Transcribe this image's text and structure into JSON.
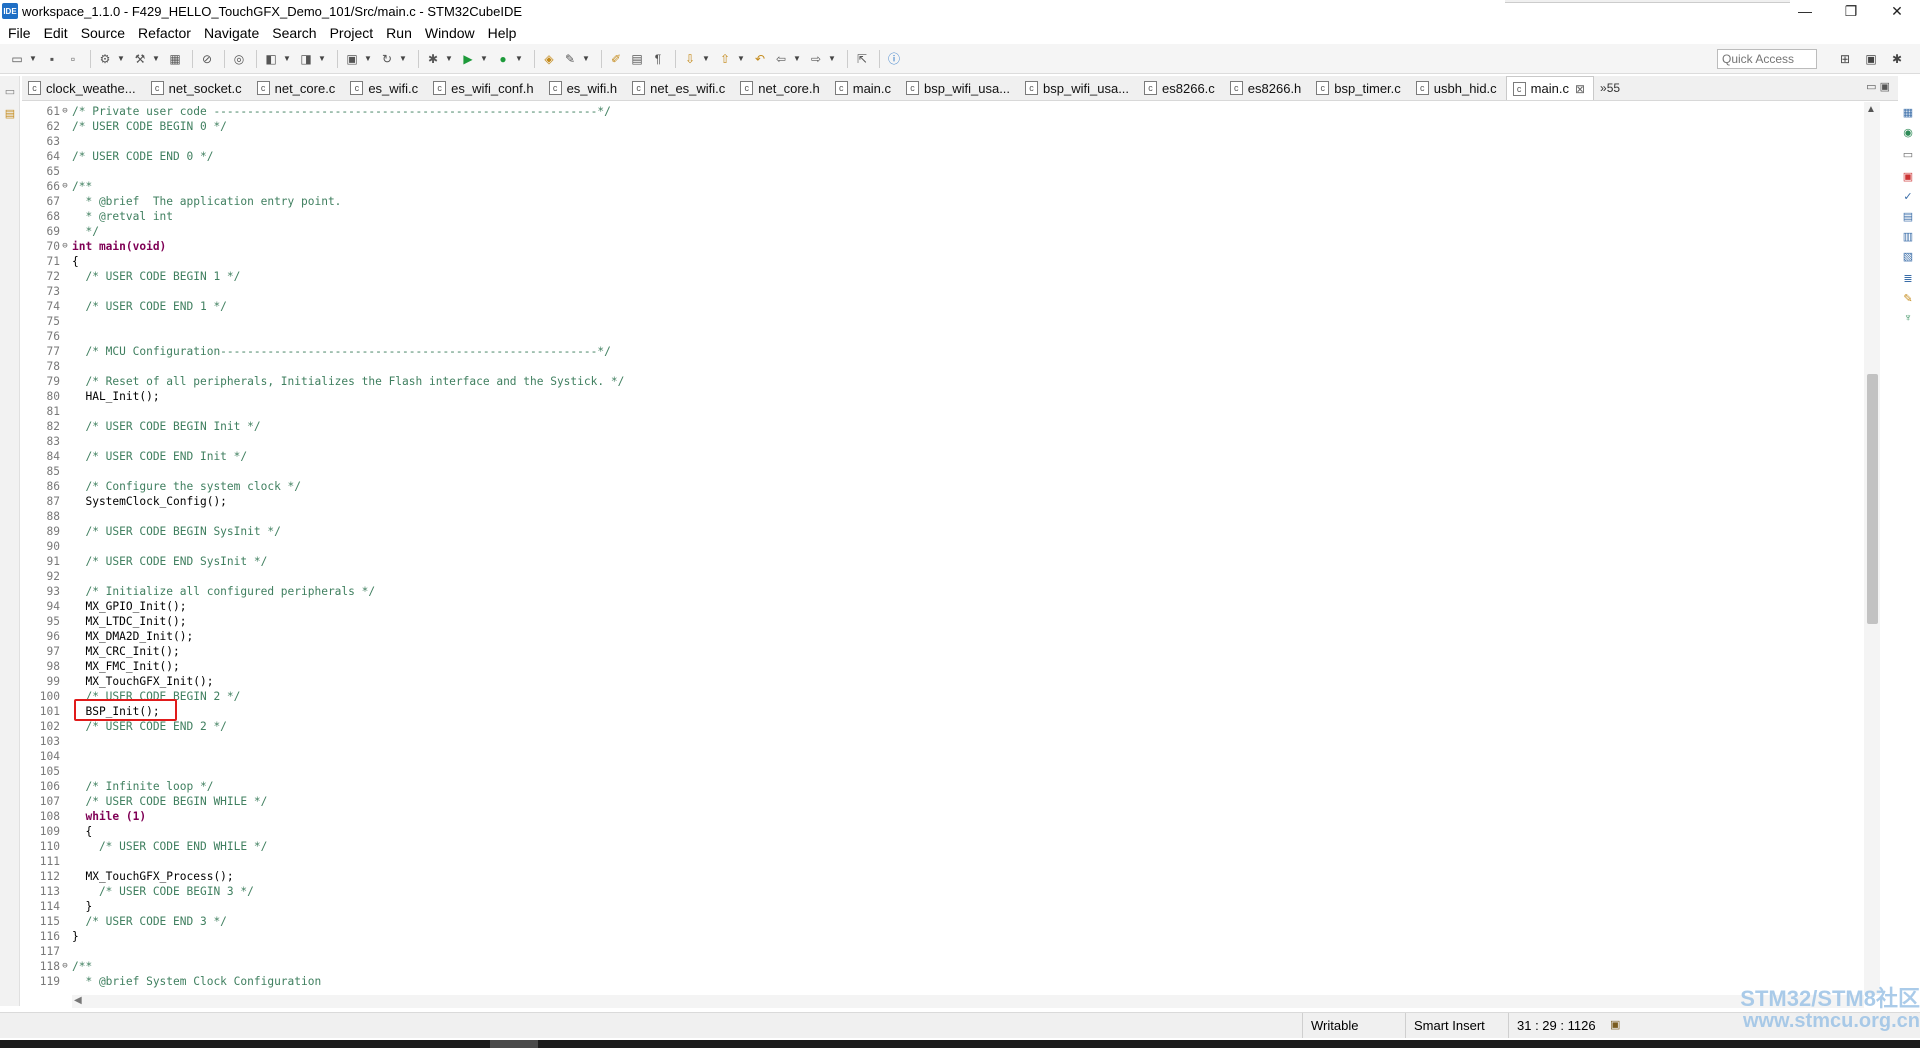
{
  "window": {
    "title": "workspace_1.1.0 - F429_HELLO_TouchGFX_Demo_101/Src/main.c - STM32CubeIDE",
    "app_icon": "IDE",
    "controls": {
      "minimize": "—",
      "maximize": "❐",
      "close": "✕"
    }
  },
  "menu": [
    "File",
    "Edit",
    "Source",
    "Refactor",
    "Navigate",
    "Search",
    "Project",
    "Run",
    "Window",
    "Help"
  ],
  "toolbar": {
    "quick_access_placeholder": "Quick Access"
  },
  "tabs": [
    {
      "label": "clock_weathe...",
      "active": false
    },
    {
      "label": "net_socket.c",
      "active": false
    },
    {
      "label": "net_core.c",
      "active": false
    },
    {
      "label": "es_wifi.c",
      "active": false
    },
    {
      "label": "es_wifi_conf.h",
      "active": false
    },
    {
      "label": "es_wifi.h",
      "active": false
    },
    {
      "label": "net_es_wifi.c",
      "active": false
    },
    {
      "label": "net_core.h",
      "active": false
    },
    {
      "label": "main.c",
      "active": false
    },
    {
      "label": "bsp_wifi_usa...",
      "active": false
    },
    {
      "label": "bsp_wifi_usa...",
      "active": false
    },
    {
      "label": "es8266.c",
      "active": false
    },
    {
      "label": "es8266.h",
      "active": false
    },
    {
      "label": "bsp_timer.c",
      "active": false
    },
    {
      "label": "usbh_hid.c",
      "active": false
    },
    {
      "label": "main.c",
      "active": true
    }
  ],
  "tab_overflow": "»55",
  "editor": {
    "lines": [
      {
        "n": "61",
        "fold": "⊖",
        "t": "/* Private user code ---------------------------------------------------------*/",
        "s": "comment"
      },
      {
        "n": "62",
        "t": "/* USER CODE BEGIN 0 */",
        "s": "comment"
      },
      {
        "n": "63",
        "t": "",
        "s": ""
      },
      {
        "n": "64",
        "t": "/* USER CODE END 0 */",
        "s": "comment"
      },
      {
        "n": "65",
        "t": "",
        "s": ""
      },
      {
        "n": "66",
        "fold": "⊖",
        "t": "/**",
        "s": "comment"
      },
      {
        "n": "67",
        "t": "  * @brief  The application entry point.",
        "s": "comment"
      },
      {
        "n": "68",
        "t": "  * @retval int",
        "s": "comment"
      },
      {
        "n": "69",
        "t": "  */",
        "s": "comment"
      },
      {
        "n": "70",
        "fold": "⊖",
        "t": "int main(void)",
        "s": "kw"
      },
      {
        "n": "71",
        "t": "{",
        "s": ""
      },
      {
        "n": "72",
        "t": "  /* USER CODE BEGIN 1 */",
        "s": "comment"
      },
      {
        "n": "73",
        "t": "",
        "s": ""
      },
      {
        "n": "74",
        "t": "  /* USER CODE END 1 */",
        "s": "comment"
      },
      {
        "n": "75",
        "t": "",
        "s": ""
      },
      {
        "n": "76",
        "t": "",
        "s": ""
      },
      {
        "n": "77",
        "t": "  /* MCU Configuration--------------------------------------------------------*/",
        "s": "comment"
      },
      {
        "n": "78",
        "t": "",
        "s": ""
      },
      {
        "n": "79",
        "t": "  /* Reset of all peripherals, Initializes the Flash interface and the Systick. */",
        "s": "comment"
      },
      {
        "n": "80",
        "t": "  HAL_Init();",
        "s": ""
      },
      {
        "n": "81",
        "t": "",
        "s": ""
      },
      {
        "n": "82",
        "t": "  /* USER CODE BEGIN Init */",
        "s": "comment"
      },
      {
        "n": "83",
        "t": "",
        "s": ""
      },
      {
        "n": "84",
        "t": "  /* USER CODE END Init */",
        "s": "comment"
      },
      {
        "n": "85",
        "t": "",
        "s": ""
      },
      {
        "n": "86",
        "t": "  /* Configure the system clock */",
        "s": "comment"
      },
      {
        "n": "87",
        "t": "  SystemClock_Config();",
        "s": ""
      },
      {
        "n": "88",
        "t": "",
        "s": ""
      },
      {
        "n": "89",
        "t": "  /* USER CODE BEGIN SysInit */",
        "s": "comment"
      },
      {
        "n": "90",
        "t": "",
        "s": ""
      },
      {
        "n": "91",
        "t": "  /* USER CODE END SysInit */",
        "s": "comment"
      },
      {
        "n": "92",
        "t": "",
        "s": ""
      },
      {
        "n": "93",
        "t": "  /* Initialize all configured peripherals */",
        "s": "comment"
      },
      {
        "n": "94",
        "t": "  MX_GPIO_Init();",
        "s": ""
      },
      {
        "n": "95",
        "t": "  MX_LTDC_Init();",
        "s": ""
      },
      {
        "n": "96",
        "t": "  MX_DMA2D_Init();",
        "s": ""
      },
      {
        "n": "97",
        "t": "  MX_CRC_Init();",
        "s": ""
      },
      {
        "n": "98",
        "t": "  MX_FMC_Init();",
        "s": ""
      },
      {
        "n": "99",
        "t": "  MX_TouchGFX_Init();",
        "s": ""
      },
      {
        "n": "100",
        "t": "  /* USER CODE BEGIN 2 */",
        "s": "comment"
      },
      {
        "n": "101",
        "t": "  BSP_Init();",
        "s": ""
      },
      {
        "n": "102",
        "t": "  /* USER CODE END 2 */",
        "s": "comment"
      },
      {
        "n": "103",
        "t": "",
        "s": ""
      },
      {
        "n": "104",
        "t": "",
        "s": ""
      },
      {
        "n": "105",
        "t": "",
        "s": ""
      },
      {
        "n": "106",
        "t": "  /* Infinite loop */",
        "s": "comment"
      },
      {
        "n": "107",
        "t": "  /* USER CODE BEGIN WHILE */",
        "s": "comment"
      },
      {
        "n": "108",
        "t": "  while (1)",
        "s": "kw"
      },
      {
        "n": "109",
        "t": "  {",
        "s": ""
      },
      {
        "n": "110",
        "t": "    /* USER CODE END WHILE */",
        "s": "comment"
      },
      {
        "n": "111",
        "t": "",
        "s": ""
      },
      {
        "n": "112",
        "t": "  MX_TouchGFX_Process();",
        "s": ""
      },
      {
        "n": "113",
        "t": "    /* USER CODE BEGIN 3 */",
        "s": "comment"
      },
      {
        "n": "114",
        "t": "  }",
        "s": ""
      },
      {
        "n": "115",
        "t": "  /* USER CODE END 3 */",
        "s": "comment"
      },
      {
        "n": "116",
        "t": "}",
        "s": ""
      },
      {
        "n": "117",
        "t": "",
        "s": ""
      },
      {
        "n": "118",
        "fold": "⊖",
        "t": "/**",
        "s": "comment"
      },
      {
        "n": "119",
        "t": "  * @brief System Clock Configuration",
        "s": "comment"
      }
    ]
  },
  "status": {
    "writable": "Writable",
    "insert_mode": "Smart Insert",
    "position": "31 : 29 : 1126"
  },
  "watermark": {
    "line1": "STM32/STM8社区",
    "line2": "www.stmcu.org.cn"
  }
}
